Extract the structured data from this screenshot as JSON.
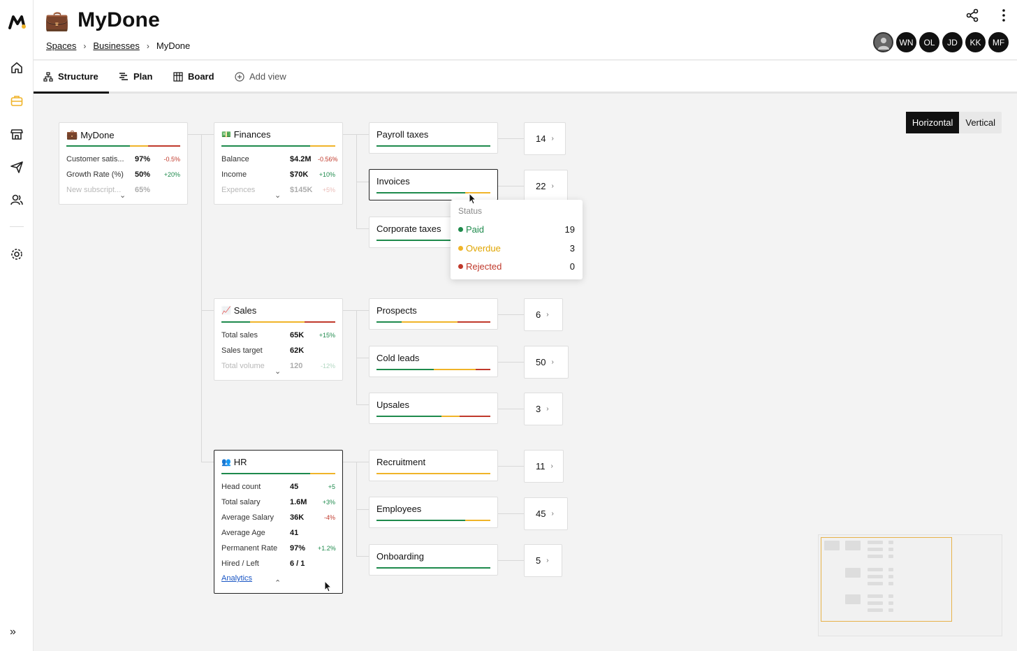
{
  "app": {
    "title": "MyDone",
    "breadcrumb": [
      "Spaces",
      "Businesses",
      "MyDone"
    ]
  },
  "header": {
    "avatars": [
      "WN",
      "OL",
      "JD",
      "KK",
      "MF"
    ]
  },
  "tabs": [
    {
      "label": "Structure",
      "icon": "structure-icon"
    },
    {
      "label": "Plan",
      "icon": "plan-icon"
    },
    {
      "label": "Board",
      "icon": "board-icon"
    },
    {
      "label": "Add view",
      "icon": "plus-circle-icon"
    }
  ],
  "view_toggle": {
    "options": [
      "Horizontal",
      "Vertical"
    ],
    "selected": "Horizontal"
  },
  "colors": {
    "green": "#1e8a4c",
    "yellow": "#f0b429",
    "red": "#c0392b",
    "accent": "#f0b429"
  },
  "root": {
    "title": "MyDone",
    "metrics": [
      {
        "label": "Customer satis...",
        "value": "97%",
        "change": "-0.5%"
      },
      {
        "label": "Growth Rate (%)",
        "value": "50%",
        "change": "+20%"
      },
      {
        "label": "New subscript...",
        "value": "65%",
        "change": ""
      }
    ]
  },
  "groups": {
    "finances": {
      "title": "Finances",
      "metrics": [
        {
          "label": "Balance",
          "value": "$4.2M",
          "change": "-0.56%"
        },
        {
          "label": "Income",
          "value": "$70K",
          "change": "+10%"
        },
        {
          "label": "Expences",
          "value": "$145K",
          "change": "+5%"
        }
      ]
    },
    "sales": {
      "title": "Sales",
      "metrics": [
        {
          "label": "Total sales",
          "value": "65K",
          "change": "+15%"
        },
        {
          "label": "Sales target",
          "value": "62K",
          "change": ""
        },
        {
          "label": "Total volume",
          "value": "120",
          "change": "-12%"
        }
      ]
    },
    "hr": {
      "title": "HR",
      "metrics": [
        {
          "label": "Head count",
          "value": "45",
          "change": "+5"
        },
        {
          "label": "Total salary",
          "value": "1.6M",
          "change": "+3%"
        },
        {
          "label": "Average Salary",
          "value": "36K",
          "change": "-4%"
        },
        {
          "label": "Average Age",
          "value": "41",
          "change": ""
        },
        {
          "label": "Permanent Rate",
          "value": "97%",
          "change": "+1.2%"
        },
        {
          "label": "Hired / Left",
          "value": "6 / 1",
          "change": ""
        }
      ],
      "link": "Analytics"
    }
  },
  "items": {
    "payroll": {
      "title": "Payroll taxes",
      "count": "14"
    },
    "invoices": {
      "title": "Invoices",
      "count": "22"
    },
    "corporate": {
      "title": "Corporate taxes",
      "count": ""
    },
    "prospects": {
      "title": "Prospects",
      "count": "6"
    },
    "cold": {
      "title": "Cold leads",
      "count": "50"
    },
    "upsales": {
      "title": "Upsales",
      "count": "3"
    },
    "recruitment": {
      "title": "Recruitment",
      "count": "11"
    },
    "employees": {
      "title": "Employees",
      "count": "45"
    },
    "onboarding": {
      "title": "Onboarding",
      "count": "5"
    }
  },
  "tooltip": {
    "title": "Status",
    "rows": [
      {
        "label": "Paid",
        "count": "19"
      },
      {
        "label": "Overdue",
        "count": "3"
      },
      {
        "label": "Rejected",
        "count": "0"
      }
    ]
  }
}
